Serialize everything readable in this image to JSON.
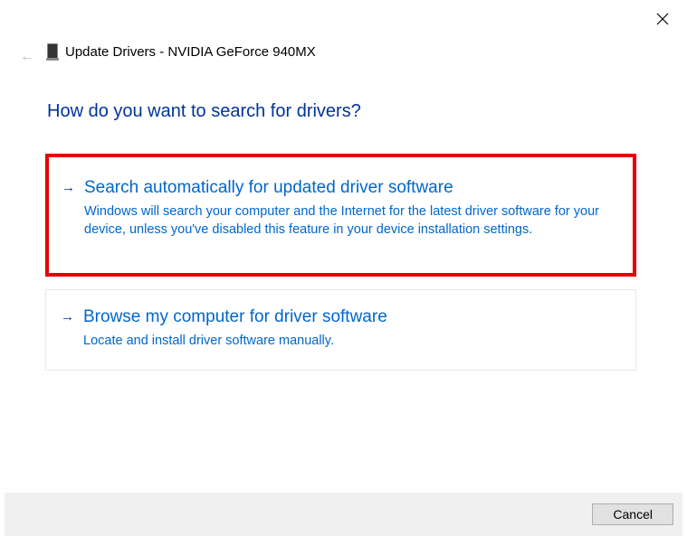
{
  "window": {
    "title": "Update Drivers - NVIDIA GeForce 940MX"
  },
  "heading": "How do you want to search for drivers?",
  "options": [
    {
      "title": "Search automatically for updated driver software",
      "description": "Windows will search your computer and the Internet for the latest driver software for your device, unless you've disabled this feature in your device installation settings."
    },
    {
      "title": "Browse my computer for driver software",
      "description": "Locate and install driver software manually."
    }
  ],
  "buttons": {
    "cancel": "Cancel"
  }
}
